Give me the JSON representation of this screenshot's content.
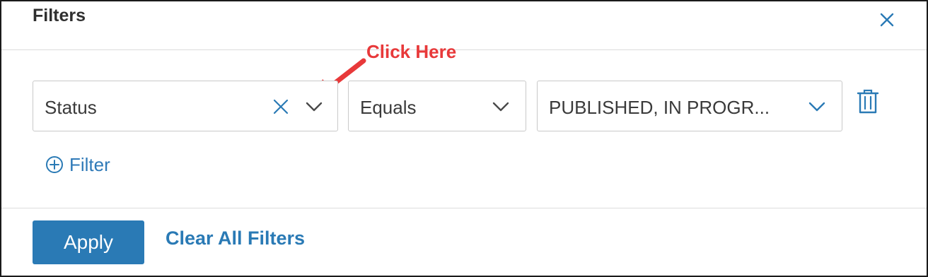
{
  "header": {
    "title": "Filters",
    "close_icon": "close-icon"
  },
  "annotation": {
    "text": "Click Here",
    "color": "#e8393a"
  },
  "filter_row": {
    "field": {
      "value": "Status",
      "clear_icon": "x-icon",
      "dropdown_icon": "chevron-down-icon"
    },
    "operator": {
      "value": "Equals",
      "dropdown_icon": "chevron-down-icon"
    },
    "value": {
      "value": "PUBLISHED, IN PROGR...",
      "dropdown_icon": "chevron-down-icon"
    },
    "delete_icon": "trash-icon"
  },
  "add_filter": {
    "label": "Filter",
    "icon": "plus-circle-icon"
  },
  "footer": {
    "apply_label": "Apply",
    "clear_label": "Clear All Filters"
  },
  "colors": {
    "accent": "#2a7ab5",
    "annotation": "#e8393a",
    "border": "#c9c9c9"
  }
}
